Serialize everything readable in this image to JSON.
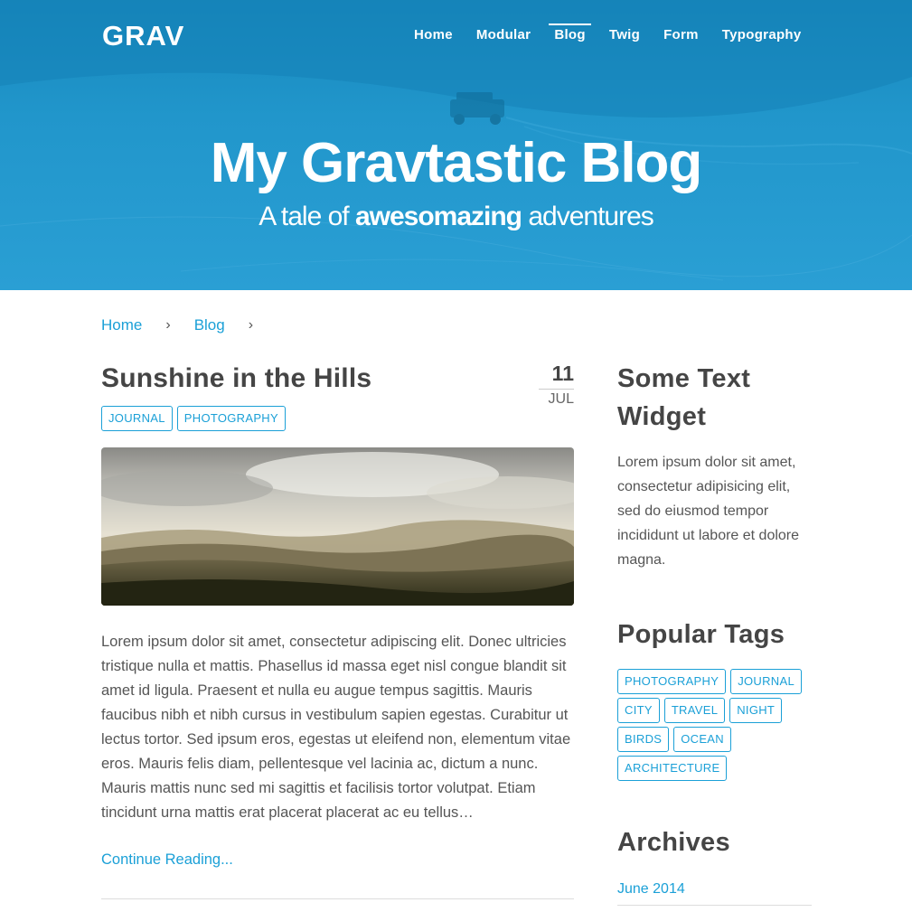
{
  "header": {
    "logo": "GRAV",
    "nav": [
      {
        "label": "Home"
      },
      {
        "label": "Modular"
      },
      {
        "label": "Blog",
        "active": true
      },
      {
        "label": "Twig"
      },
      {
        "label": "Form"
      },
      {
        "label": "Typography"
      }
    ]
  },
  "hero": {
    "title": "My Gravtastic Blog",
    "subtitle_pre": "A tale of ",
    "subtitle_bold": "awesomazing",
    "subtitle_post": " adventures"
  },
  "breadcrumb": {
    "items": [
      "Home",
      "Blog"
    ],
    "separator": "›"
  },
  "post": {
    "title": "Sunshine in the Hills",
    "date_day": "11",
    "date_month": "JUL",
    "tags": [
      "JOURNAL",
      "PHOTOGRAPHY"
    ],
    "body": "Lorem ipsum dolor sit amet, consectetur adipiscing elit. Donec ultricies tristique nulla et mattis. Phasellus id massa eget nisl congue blandit sit amet id ligula. Praesent et nulla eu augue tempus sagittis. Mauris faucibus nibh et nibh cursus in vestibulum sapien egestas. Curabitur ut lectus tortor. Sed ipsum eros, egestas ut eleifend non, elementum vitae eros. Mauris felis diam, pellentesque vel lacinia ac, dictum a nunc. Mauris mattis nunc sed mi sagittis et facilisis tortor volutpat. Etiam tincidunt urna mattis erat placerat placerat ac eu tellus…",
    "continue_label": "Continue Reading..."
  },
  "sidebar": {
    "text_widget_title": "Some Text Widget",
    "text_widget_body": "Lorem ipsum dolor sit amet, consectetur adipisicing elit, sed do eiusmod tempor incididunt ut labore et dolore magna.",
    "popular_tags_title": "Popular Tags",
    "popular_tags": [
      "PHOTOGRAPHY",
      "JOURNAL",
      "CITY",
      "TRAVEL",
      "NIGHT",
      "BIRDS",
      "OCEAN",
      "ARCHITECTURE"
    ],
    "archives_title": "Archives",
    "archives": [
      "June 2014"
    ]
  },
  "colors": {
    "accent": "#1ba0d7",
    "hero_blue": "#1f8fc3",
    "heading": "#454545"
  }
}
